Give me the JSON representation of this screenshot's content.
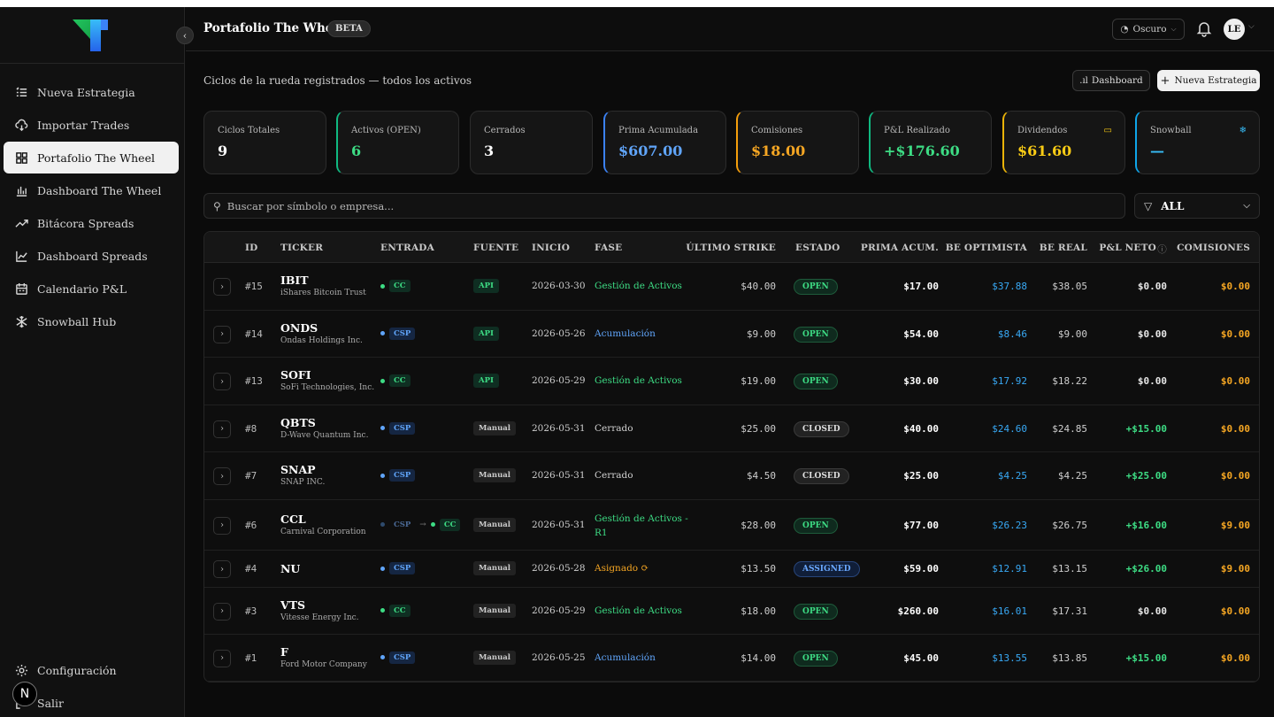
{
  "sidebar": {
    "items": [
      {
        "label": "Nueva Estrategia",
        "icon": "list-icon"
      },
      {
        "label": "Importar Trades",
        "icon": "cloud-icon"
      },
      {
        "label": "Portafolio The Wheel",
        "icon": "grid-icon",
        "active": true
      },
      {
        "label": "Dashboard The Wheel",
        "icon": "bar-chart-icon"
      },
      {
        "label": "Bitácora Spreads",
        "icon": "trend-icon"
      },
      {
        "label": "Dashboard Spreads",
        "icon": "line-chart-icon"
      },
      {
        "label": "Calendario P&L",
        "icon": "calendar-icon"
      },
      {
        "label": "Snowball Hub",
        "icon": "snowflake-icon"
      }
    ],
    "bottom": [
      {
        "label": "Configuración",
        "icon": "gear-icon"
      },
      {
        "label": "Salir",
        "icon": "logout-icon"
      }
    ],
    "badge": "N"
  },
  "topbar": {
    "title": "Portafolio The Wheel",
    "badge": "BETA",
    "theme": "Oscuro",
    "avatar": "LE"
  },
  "page": {
    "subtitle": "Ciclos de la rueda registrados — todos los activos",
    "dashboard_btn": "Dashboard",
    "new_btn": "Nueva Estrategia"
  },
  "cards": [
    {
      "label": "Ciclos Totales",
      "value": "9",
      "accent": "#2c2c2c",
      "color": "#ffffff"
    },
    {
      "label": "Activos (OPEN)",
      "value": "6",
      "accent": "#10b981",
      "color": "#3ddc84"
    },
    {
      "label": "Cerrados",
      "value": "3",
      "accent": "#2c2c2c",
      "color": "#ffffff"
    },
    {
      "label": "Prima Acumulada",
      "value": "$607.00",
      "accent": "#3b82f6",
      "color": "#60a5fa"
    },
    {
      "label": "Comisiones",
      "value": "$18.00",
      "accent": "#f59e0b",
      "color": "#f5a623"
    },
    {
      "label": "P&L Realizado",
      "value": "+$176.60",
      "accent": "#10b981",
      "color": "#3ddc84"
    },
    {
      "label": "Dividendos",
      "value": "$61.60",
      "accent": "#eab308",
      "color": "#facc15",
      "icon": "wallet-icon"
    },
    {
      "label": "Snowball",
      "value": "—",
      "accent": "#0ea5e9",
      "color": "#38bdf8",
      "icon": "snowflake-icon"
    }
  ],
  "search": {
    "placeholder": "Buscar por símbolo o empresa..."
  },
  "filter": {
    "value": "ALL"
  },
  "table": {
    "headers": [
      "ID",
      "TICKER",
      "ENTRADA",
      "FUENTE",
      "INICIO",
      "FASE",
      "ÚLTIMO STRIKE",
      "ESTADO",
      "PRIMA ACUM.",
      "BE OPTIMISTA",
      "BE REAL",
      "P&L NETO",
      "COMISIONES"
    ],
    "rows": [
      {
        "id": "#15",
        "ticker": "IBIT",
        "name": "iShares Bitcoin Trust",
        "entry": "CC",
        "source": "API",
        "start": "2026-03-30",
        "phase": "Gestión de Activos",
        "phase2": "",
        "strike": "$40.00",
        "state": "OPEN",
        "prima": "$17.00",
        "be_opt": "$37.88",
        "be_real": "$38.05",
        "pnl": "$0.00",
        "com": "$0.00"
      },
      {
        "id": "#14",
        "ticker": "ONDS",
        "name": "Ondas Holdings Inc.",
        "entry": "CSP",
        "source": "API",
        "start": "2026-05-26",
        "phase": "Acumulación",
        "phase2": "",
        "strike": "$9.00",
        "state": "OPEN",
        "prima": "$54.00",
        "be_opt": "$8.46",
        "be_real": "$9.00",
        "pnl": "$0.00",
        "com": "$0.00"
      },
      {
        "id": "#13",
        "ticker": "SOFI",
        "name": "SoFi Technologies, Inc.",
        "entry": "CC",
        "source": "API",
        "start": "2026-05-29",
        "phase": "Gestión de Activos",
        "phase2": "",
        "strike": "$19.00",
        "state": "OPEN",
        "prima": "$30.00",
        "be_opt": "$17.92",
        "be_real": "$18.22",
        "pnl": "$0.00",
        "com": "$0.00"
      },
      {
        "id": "#8",
        "ticker": "QBTS",
        "name": "D-Wave Quantum Inc.",
        "entry": "CSP",
        "source": "Manual",
        "start": "2026-05-31",
        "phase": "Cerrado",
        "phase2": "",
        "strike": "$25.00",
        "state": "CLOSED",
        "prima": "$40.00",
        "be_opt": "$24.60",
        "be_real": "$24.85",
        "pnl": "+$15.00",
        "com": "$0.00"
      },
      {
        "id": "#7",
        "ticker": "SNAP",
        "name": "SNAP INC.",
        "entry": "CSP",
        "source": "Manual",
        "start": "2026-05-31",
        "phase": "Cerrado",
        "phase2": "",
        "strike": "$4.50",
        "state": "CLOSED",
        "prima": "$25.00",
        "be_opt": "$4.25",
        "be_real": "$4.25",
        "pnl": "+$25.00",
        "com": "$0.00"
      },
      {
        "id": "#6",
        "ticker": "CCL",
        "name": "Carnival Corporation",
        "entry": "CSP",
        "entry2": "CC",
        "source": "Manual",
        "start": "2026-05-31",
        "phase": "Gestión de Activos -",
        "phase2": "R1",
        "strike": "$28.00",
        "state": "OPEN",
        "prima": "$77.00",
        "be_opt": "$26.23",
        "be_real": "$26.75",
        "pnl": "+$16.00",
        "com": "$9.00"
      },
      {
        "id": "#4",
        "ticker": "NU",
        "name": "",
        "entry": "CSP",
        "source": "Manual",
        "start": "2026-05-28",
        "phase": "Asignado",
        "phase2": "",
        "strike": "$13.50",
        "state": "ASSIGNED",
        "prima": "$59.00",
        "be_opt": "$12.91",
        "be_real": "$13.15",
        "pnl": "+$26.00",
        "com": "$9.00"
      },
      {
        "id": "#3",
        "ticker": "VTS",
        "name": "Vitesse Energy Inc.",
        "entry": "CC",
        "source": "Manual",
        "start": "2026-05-29",
        "phase": "Gestión de Activos",
        "phase2": "",
        "strike": "$18.00",
        "state": "OPEN",
        "prima": "$260.00",
        "be_opt": "$16.01",
        "be_real": "$17.31",
        "pnl": "$0.00",
        "com": "$0.00"
      },
      {
        "id": "#1",
        "ticker": "F",
        "name": "Ford Motor Company",
        "entry": "CSP",
        "source": "Manual",
        "start": "2026-05-25",
        "phase": "Acumulación",
        "phase2": "",
        "strike": "$14.00",
        "state": "OPEN",
        "prima": "$45.00",
        "be_opt": "$13.55",
        "be_real": "$13.85",
        "pnl": "+$15.00",
        "com": "$0.00"
      }
    ]
  }
}
